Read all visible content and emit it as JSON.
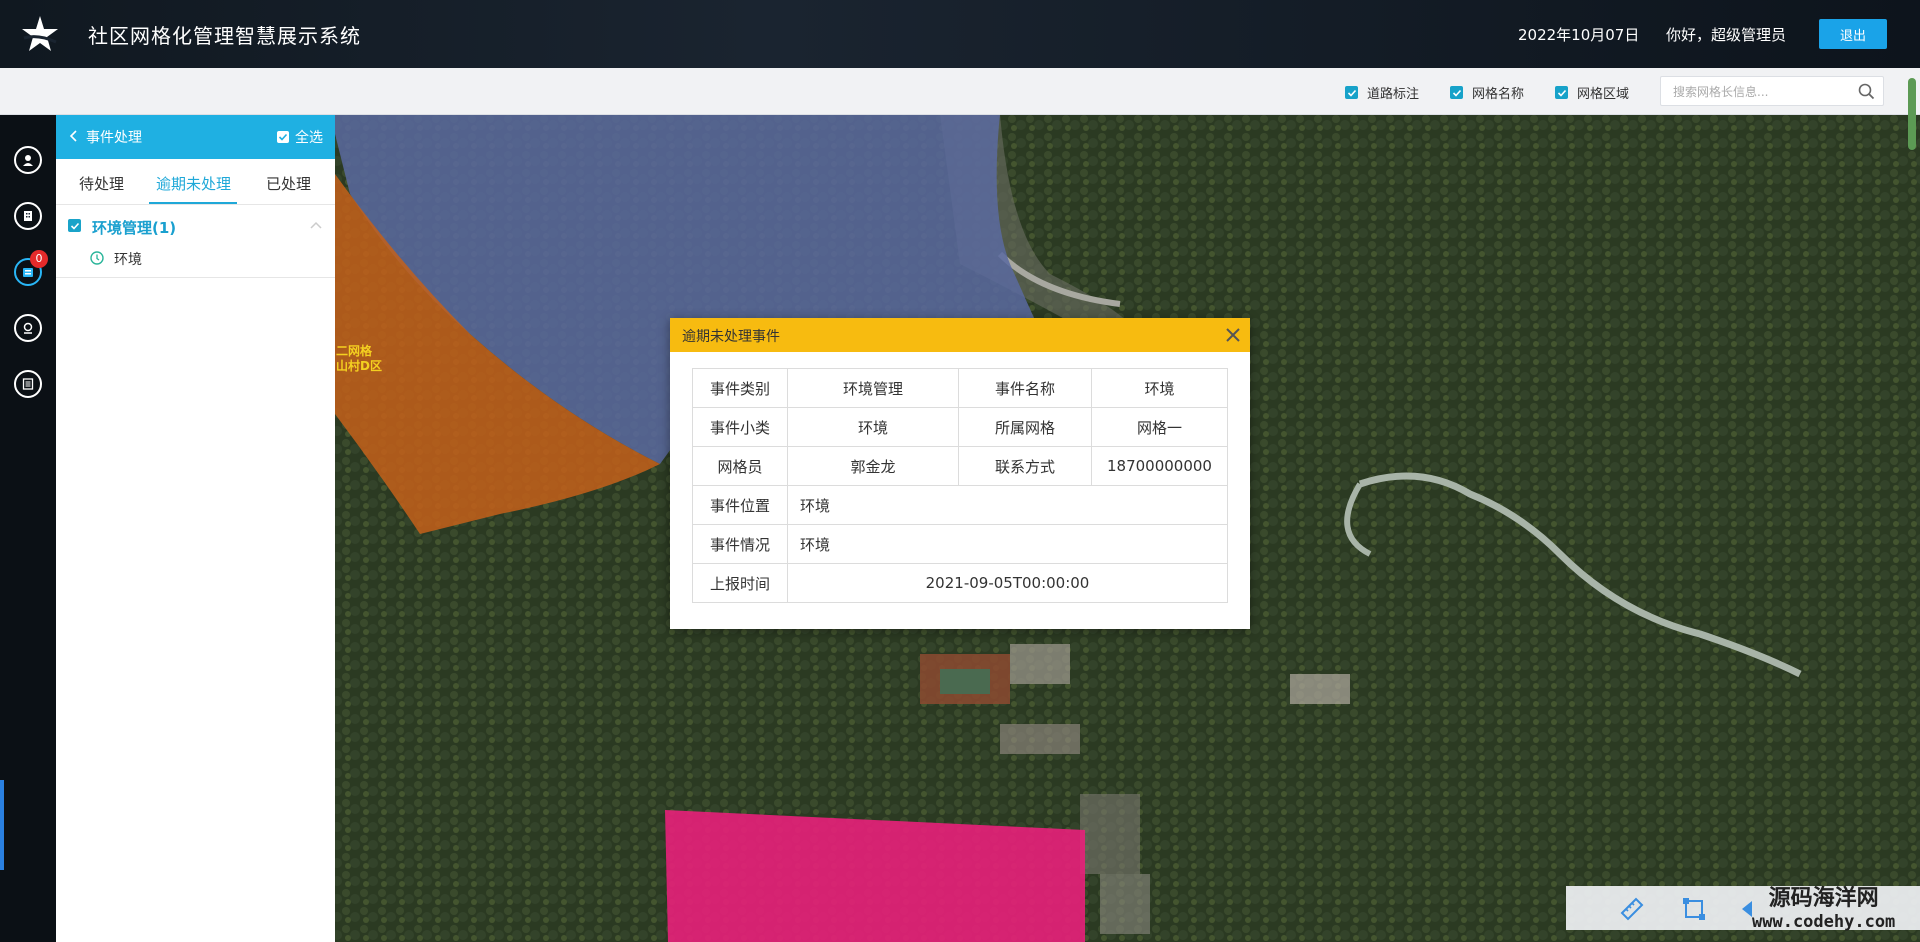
{
  "header": {
    "title": "社区网格化管理智慧展示系统",
    "date": "2022年10月07日",
    "greeting": "你好，超级管理员",
    "logout_label": "退出"
  },
  "toolbar": {
    "checks": [
      {
        "label": "道路标注",
        "checked": true
      },
      {
        "label": "网格名称",
        "checked": true
      },
      {
        "label": "网格区域",
        "checked": true
      }
    ],
    "search_placeholder": "搜索网格长信息..."
  },
  "rail": {
    "items": [
      {
        "icon": "user-icon"
      },
      {
        "icon": "building-icon"
      },
      {
        "icon": "event-icon",
        "badge": "0",
        "active": true
      },
      {
        "icon": "location-icon"
      },
      {
        "icon": "list-icon"
      }
    ]
  },
  "panel": {
    "title": "事件处理",
    "select_all": "全选",
    "tabs": [
      {
        "label": "待处理",
        "active": false
      },
      {
        "label": "逾期未处理",
        "active": true
      },
      {
        "label": "已处理",
        "active": false
      }
    ],
    "groups": [
      {
        "label": "环境管理(1)",
        "items": [
          {
            "label": "环境"
          }
        ]
      }
    ]
  },
  "map_labels": [
    {
      "text": "二网格"
    },
    {
      "text": "山村D区"
    }
  ],
  "dialog": {
    "title": "逾期未处理事件",
    "rows": {
      "r1": {
        "l1": "事件类别",
        "v1": "环境管理",
        "l2": "事件名称",
        "v2": "环境"
      },
      "r2": {
        "l1": "事件小类",
        "v1": "环境",
        "l2": "所属网格",
        "v2": "网格一"
      },
      "r3": {
        "l1": "网格员",
        "v1": "郭金龙",
        "l2": "联系方式",
        "v2": "18700000000"
      },
      "r4": {
        "l1": "事件位置",
        "v": "环境"
      },
      "r5": {
        "l1": "事件情况",
        "v": "环境"
      },
      "r6": {
        "l1": "上报时间",
        "v": "2021-09-05T00:00:00"
      }
    }
  },
  "tools": {
    "items": [
      {
        "icon": "ruler-icon"
      },
      {
        "icon": "polygon-icon"
      },
      {
        "icon": "arrow-icon"
      }
    ]
  },
  "watermark": {
    "line1": "源码海洋网",
    "line2": "www.codehy.com"
  },
  "colors": {
    "accent": "#1fb0e2",
    "dialog_header": "#f7bb10",
    "badge": "#e52a2a",
    "zone_blue": "#5a6aa0",
    "zone_orange": "#c4601a",
    "zone_pink": "#e8207a"
  }
}
